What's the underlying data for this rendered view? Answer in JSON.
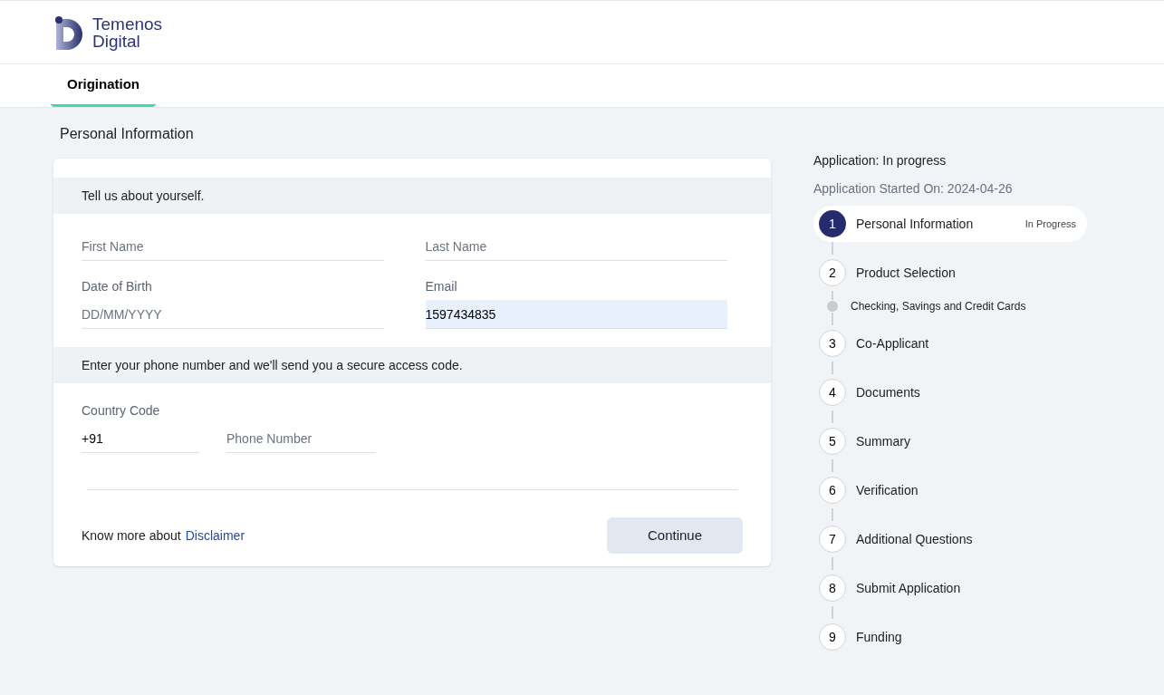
{
  "header": {
    "logo_text": [
      "Temenos",
      "Digital"
    ]
  },
  "tabs": [
    {
      "label": "Origination",
      "selected": true
    }
  ],
  "page_title": "Personal Information",
  "form": {
    "sections": [
      {
        "heading": "Tell us about yourself.",
        "rows": [
          [
            {
              "placeholder": "First Name"
            },
            {
              "placeholder": "Last Name"
            }
          ],
          [
            {
              "label": "Date of Birth",
              "placeholder": "DD/MM/YYYY"
            },
            {
              "label": "Email",
              "value": "1597434835",
              "highlighted": true
            }
          ]
        ]
      },
      {
        "heading": "Enter your phone number and we'll send you a secure access code.",
        "rows": [
          [
            {
              "label": "Country Code",
              "value": "+91",
              "kind": "code"
            },
            {
              "placeholder": "Phone Number",
              "kind": "phone"
            }
          ]
        ]
      }
    ],
    "footer_text": "Know more about",
    "footer_link": "Disclaimer",
    "button": "Continue"
  },
  "progress": {
    "status": "Application: In progress",
    "started": "Application Started On: 2024-04-26",
    "steps": [
      {
        "number": "1",
        "label": "Personal Information",
        "selected": true,
        "status": "In Progress"
      },
      {
        "number": "2",
        "label": "Product Selection",
        "selected": false,
        "children": [
          {
            "label": "Checking, Savings and Credit Cards"
          }
        ]
      },
      {
        "number": "3",
        "label": "Co-Applicant",
        "selected": false
      },
      {
        "number": "4",
        "label": "Documents",
        "selected": false
      },
      {
        "number": "5",
        "label": "Summary",
        "selected": false
      },
      {
        "number": "6",
        "label": "Verification",
        "selected": false
      },
      {
        "number": "7",
        "label": "Additional Questions",
        "selected": false
      },
      {
        "number": "8",
        "label": "Submit Application",
        "selected": false
      },
      {
        "number": "9",
        "label": "Funding",
        "selected": false
      }
    ]
  }
}
